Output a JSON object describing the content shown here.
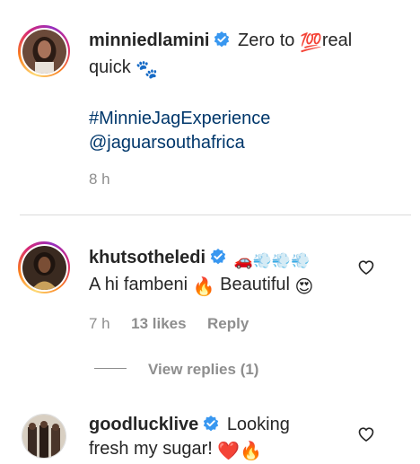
{
  "post_caption": {
    "username": "minniedlamini",
    "text_line1": "Zero to",
    "hundred_emoji": "💯",
    "text_line1_end": "real",
    "text_line2": "quick",
    "paw_emoji": "🐾",
    "hashtag": "#MinnieJagExperience",
    "mention": "@jaguarsouthafrica",
    "time": "8 h"
  },
  "comments": [
    {
      "username": "khutsotheledi",
      "badge_emojis": "🚗💨💨💨",
      "text": "A hi fambeni",
      "emoji1": "🔥",
      "text2": "Beautiful",
      "emoji2": "😍",
      "time": "7 h",
      "likes": "13 likes",
      "reply_label": "Reply",
      "view_replies": "View replies (1)"
    },
    {
      "username": "goodlucklive",
      "text_line1": "Looking",
      "text_line2": "fresh my sugar!",
      "emoji1": "❤️",
      "emoji2": "🔥"
    }
  ],
  "icons": {
    "verified": "verified-badge-icon",
    "like": "heart-outline-icon"
  },
  "colors": {
    "verified_blue": "#3897f0",
    "link_blue": "#00376b",
    "meta_gray": "#8e8e8e"
  }
}
